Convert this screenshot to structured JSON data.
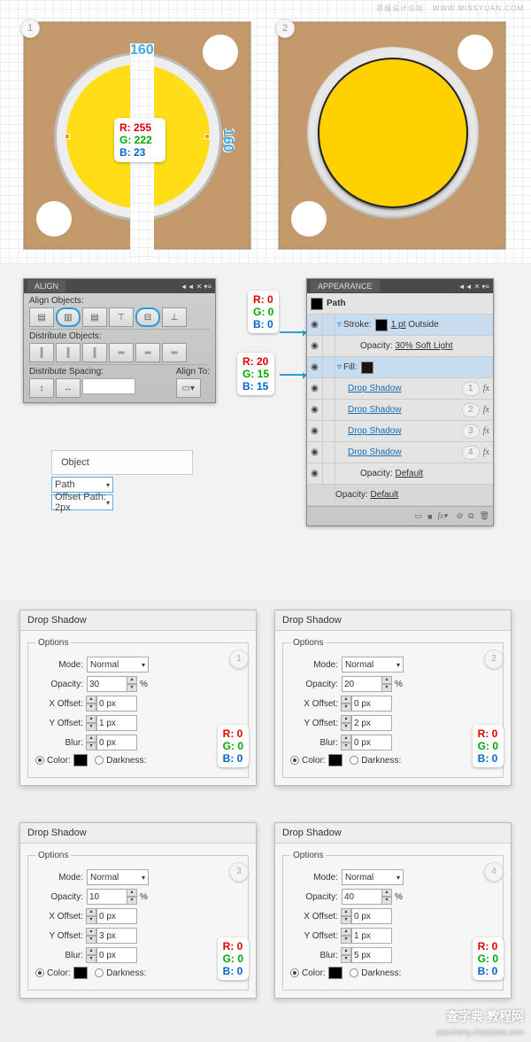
{
  "header": {
    "cn": "思缘设计论坛",
    "url": "WWW.MISSYUAN.COM"
  },
  "step": {
    "s1": "1",
    "s2": "2",
    "s3": "3",
    "s4": "4"
  },
  "dims": {
    "w": "160",
    "h": "160"
  },
  "rgbYellow": {
    "r": "R: 255",
    "g": "G: 222",
    "b": "B: 23"
  },
  "rgbBlack": {
    "r": "R: 0",
    "g": "G: 0",
    "b": "B: 0"
  },
  "rgbDark": {
    "r": "R: 20",
    "g": "G: 15",
    "b": "B: 15"
  },
  "align": {
    "tab": "ALIGN",
    "s1": "Align Objects:",
    "s2": "Distribute Objects:",
    "s3": "Distribute Spacing:",
    "s4": "Align To:"
  },
  "boxes": {
    "obj": "Object",
    "path": "Path",
    "off": "Offset Path: 2px"
  },
  "app": {
    "tab": "APPEARANCE",
    "path": "Path",
    "stroke": "Stroke:",
    "strokeV": "1 pt",
    "strokeP": "Outside",
    "op": "Opacity:",
    "opV": "30% Soft Light",
    "fill": "Fill:",
    "ds": "Drop Shadow",
    "opD": "Default"
  },
  "ds": [
    {
      "title": "Drop Shadow",
      "mode": "Normal",
      "op": "30",
      "xo": "0 px",
      "yo": "1 px",
      "bl": "0 px"
    },
    {
      "title": "Drop Shadow",
      "mode": "Normal",
      "op": "20",
      "xo": "0 px",
      "yo": "2 px",
      "bl": "0 px"
    },
    {
      "title": "Drop Shadow",
      "mode": "Normal",
      "op": "10",
      "xo": "0 px",
      "yo": "3 px",
      "bl": "0 px"
    },
    {
      "title": "Drop Shadow",
      "mode": "Normal",
      "op": "40",
      "xo": "0 px",
      "yo": "1 px",
      "bl": "5 px"
    }
  ],
  "dsL": {
    "opt": "Options",
    "mode": "Mode:",
    "op": "Opacity:",
    "xo": "X Offset:",
    "yo": "Y Offset:",
    "bl": "Blur:",
    "col": "Color:",
    "dk": "Darkness:",
    "pct": "%"
  },
  "dsRGB": {
    "r": "R: 0",
    "g": "G: 0",
    "b": "B: 0"
  },
  "wm": {
    "a": "查字典 教程网",
    "b": "jiaocheng.chazidian.com"
  }
}
